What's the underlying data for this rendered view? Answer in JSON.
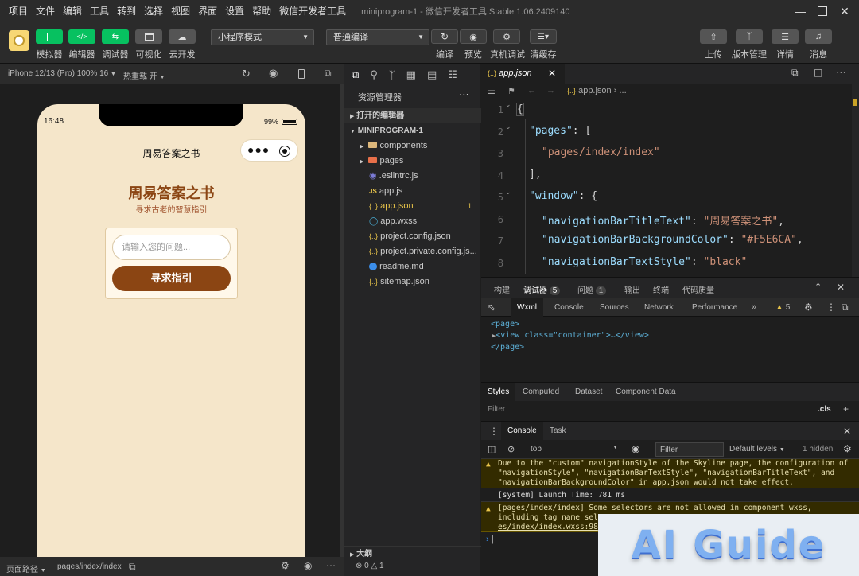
{
  "menubar": {
    "items": [
      "项目",
      "文件",
      "编辑",
      "工具",
      "转到",
      "选择",
      "视图",
      "界面",
      "设置",
      "帮助",
      "微信开发者工具"
    ],
    "window_title": "miniprogram-1 - 微信开发者工具 Stable 1.06.2409140"
  },
  "toolbar": {
    "simulator": "模拟器",
    "editor": "编辑器",
    "debugger": "调试器",
    "visual": "可视化",
    "cloud": "云开发",
    "mode_select": "小程序模式",
    "compile_select": "普通编译",
    "compile": "编译",
    "preview": "预览",
    "real_debug": "真机调试",
    "clear_cache": "清缓存",
    "upload": "上传",
    "version": "版本管理",
    "details": "详情",
    "messages": "消息"
  },
  "simbar": {
    "device": "iPhone 12/13 (Pro) 100% 16",
    "hot_reload": "热重载 开"
  },
  "phone": {
    "time": "16:48",
    "battery": "99%",
    "nav_title": "周易答案之书",
    "heading": "周易答案之书",
    "subheading": "寻求古老的智慧指引",
    "input_placeholder": "请输入您的问题...",
    "button": "寻求指引"
  },
  "statusbar": {
    "page_path_label": "页面路径",
    "page_path": "pages/index/index",
    "errors": "0",
    "warnings": "1"
  },
  "explorer": {
    "title": "资源管理器",
    "open_editors": "打开的编辑器",
    "project": "MINIPROGRAM-1",
    "outline": "大纲",
    "files": [
      {
        "name": "components",
        "icon": "folder",
        "color": "#dcb67a"
      },
      {
        "name": "pages",
        "icon": "folder",
        "color": "#e8704a"
      },
      {
        "name": ".eslintrc.js",
        "icon": "eslint",
        "color": "#7b7bd6"
      },
      {
        "name": "app.js",
        "icon": "js",
        "color": "#e8c44a"
      },
      {
        "name": "app.json",
        "icon": "json",
        "color": "#e8c44a",
        "badge": "1"
      },
      {
        "name": "app.wxss",
        "icon": "wxss",
        "color": "#4ab0d8"
      },
      {
        "name": "project.config.json",
        "icon": "json",
        "color": "#e8c44a"
      },
      {
        "name": "project.private.config.js...",
        "icon": "json",
        "color": "#e8c44a"
      },
      {
        "name": "readme.md",
        "icon": "info",
        "color": "#3b8eea"
      },
      {
        "name": "sitemap.json",
        "icon": "json",
        "color": "#e8c44a"
      }
    ]
  },
  "editor": {
    "tab": "app.json",
    "breadcrumb": "app.json",
    "breadcrumb_more": "...",
    "line_numbers": [
      "1",
      "2",
      "3",
      "4",
      "5",
      "6",
      "7",
      "8"
    ],
    "lines": {
      "l2_key": "\"pages\"",
      "l2_rest": ": [",
      "l3": "\"pages/index/index\"",
      "l4": "],",
      "l5_key": "\"window\"",
      "l5_rest": ": {",
      "l6_key": "\"navigationBarTitleText\"",
      "l6_val": "\"周易答案之书\"",
      "l7_key": "\"navigationBarBackgroundColor\"",
      "l7_val": "\"#F5E6CA\"",
      "l8_key": "\"navigationBarTextStyle\"",
      "l8_val": "\"black\""
    }
  },
  "debug": {
    "tabs": [
      "构建",
      "调试器",
      "问题",
      "输出",
      "终端",
      "代码质量"
    ],
    "debugger_badge": "5",
    "issues_badge": "1",
    "devtools_tabs": [
      "Wxml",
      "Console",
      "Sources",
      "Network",
      "Performance"
    ],
    "warn_count": "5",
    "wxml": {
      "page_open": "<page>",
      "view_line": "<view class=\"container\">…</view>",
      "page_close": "</page>"
    },
    "style_tabs": [
      "Styles",
      "Computed",
      "Dataset",
      "Component Data"
    ],
    "filter_placeholder": "Filter",
    "cls": ".cls",
    "console_tabs": [
      "Console",
      "Task"
    ],
    "context": "top",
    "console_filter": "Filter",
    "levels": "Default levels",
    "hidden": "1 hidden",
    "messages": [
      {
        "type": "warn",
        "text": "Due to the \"custom\" navigationStyle of the Skyline page, the configuration of \"navigationStyle\", \"navigationBarTextStyle\", \"navigationBarTitleText\", and \"navigationBarBackgroundColor\" in app.json would not take effect."
      },
      {
        "type": "log",
        "text": "[system] Launch Time: 781 ms"
      },
      {
        "type": "warn",
        "text": "[pages/index/index] Some selectors are not allowed in component wxss, including tag name sel"
      },
      {
        "type": "link",
        "text": "es/index/index.wxss:98"
      }
    ]
  },
  "watermark": "AI Guide",
  "colors": {
    "accent": "#07c160",
    "phone_bg": "#F5E6CA",
    "button_brown": "#8b4513",
    "heading_brown": "#8b4513"
  }
}
